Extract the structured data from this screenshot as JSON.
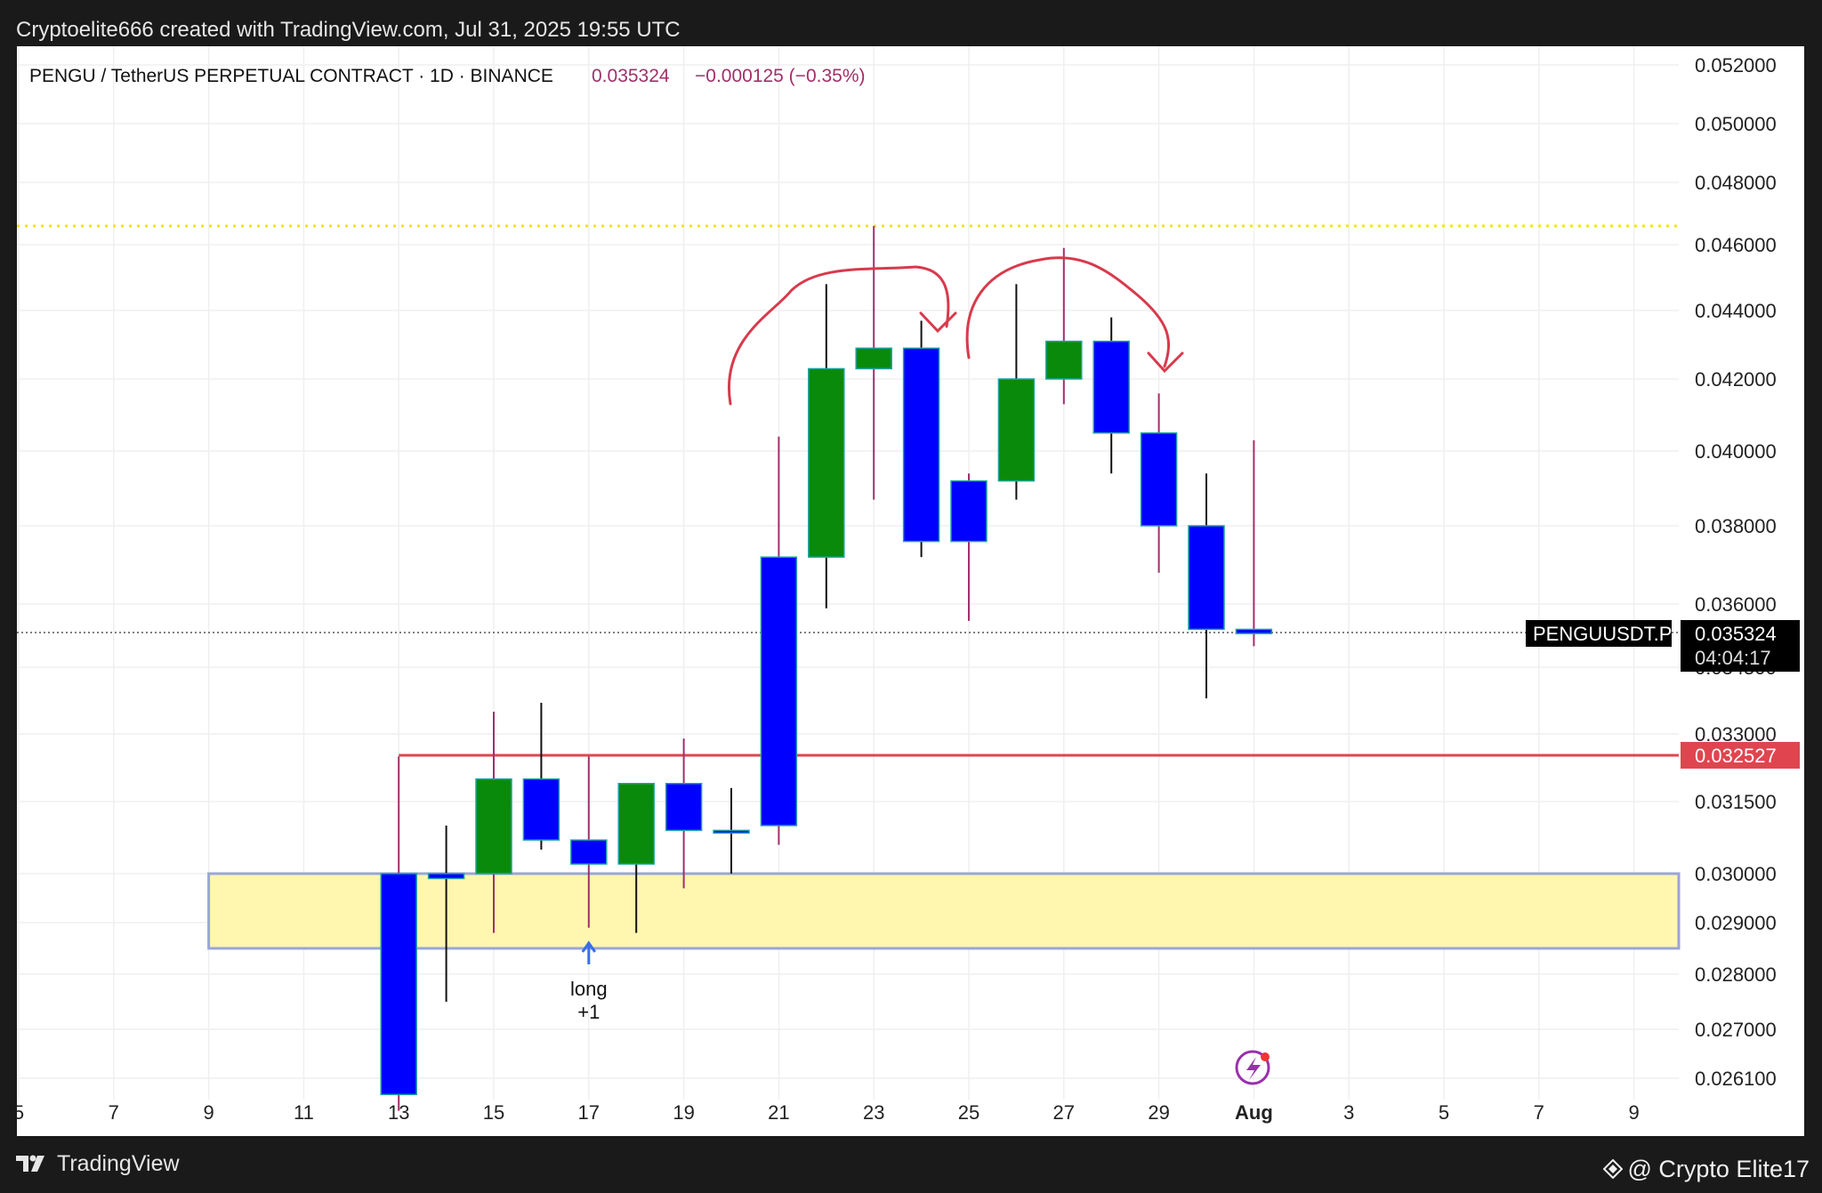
{
  "watermark": "Cryptoelite666 created with TradingView.com, Jul 31, 2025 19:55 UTC",
  "header": {
    "instrument": "PENGU / TetherUS PERPETUAL CONTRACT · 1D · BINANCE",
    "last_price": "0.035324",
    "change": "−0.000125 (−0.35%)"
  },
  "footer": {
    "brand": "TradingView",
    "credit": "@ Crypto Elite17"
  },
  "colors": {
    "up": "#0a8a0a",
    "down": "#0000ff",
    "wick_up": "#a0306a",
    "zone_fill": "#fff6b0",
    "zone_border": "#9aa6d6",
    "resistance": "#e0454f",
    "dotted_level": "#f2e02a",
    "annotation": "#d83a4c",
    "axis_text": "#222222"
  },
  "chart_data": {
    "type": "candlestick",
    "title": "PENGU / TetherUS PERPETUAL CONTRACT · 1D · BINANCE",
    "x_ticks": [
      "5",
      "7",
      "9",
      "11",
      "13",
      "15",
      "17",
      "19",
      "21",
      "23",
      "25",
      "27",
      "29",
      "Aug",
      "3",
      "5",
      "7",
      "9"
    ],
    "y_ticks": [
      "0.052000",
      "0.050000",
      "0.048000",
      "0.046000",
      "0.044000",
      "0.042000",
      "0.040000",
      "0.038000",
      "0.036000",
      "0.034500",
      "0.033000",
      "0.031500",
      "0.030000",
      "0.029000",
      "0.028000",
      "0.027000",
      "0.026100"
    ],
    "y_tick_values": [
      0.052,
      0.05,
      0.048,
      0.046,
      0.044,
      0.042,
      0.04,
      0.038,
      0.036,
      0.0345,
      0.033,
      0.0315,
      0.03,
      0.029,
      0.028,
      0.027,
      0.0261
    ],
    "candles": [
      {
        "date": "Jul 13",
        "open": 0.03,
        "high": 0.0325,
        "low": 0.0255,
        "close": 0.0258
      },
      {
        "date": "Jul 14",
        "open": 0.03,
        "high": 0.031,
        "low": 0.0275,
        "close": 0.0299
      },
      {
        "date": "Jul 15",
        "open": 0.03,
        "high": 0.0335,
        "low": 0.0288,
        "close": 0.032
      },
      {
        "date": "Jul 16",
        "open": 0.032,
        "high": 0.0337,
        "low": 0.0305,
        "close": 0.0307
      },
      {
        "date": "Jul 17",
        "open": 0.0307,
        "high": 0.0325,
        "low": 0.0289,
        "close": 0.0302
      },
      {
        "date": "Jul 18",
        "open": 0.0302,
        "high": 0.0319,
        "low": 0.0288,
        "close": 0.0319
      },
      {
        "date": "Jul 19",
        "open": 0.0319,
        "high": 0.0329,
        "low": 0.0297,
        "close": 0.0309
      },
      {
        "date": "Jul 20",
        "open": 0.0309,
        "high": 0.0318,
        "low": 0.03,
        "close": 0.0309
      },
      {
        "date": "Jul 21",
        "open": 0.0372,
        "high": 0.0404,
        "low": 0.0306,
        "close": 0.031
      },
      {
        "date": "Jul 22",
        "open": 0.0372,
        "high": 0.0448,
        "low": 0.0359,
        "close": 0.0423
      },
      {
        "date": "Jul 23",
        "open": 0.0423,
        "high": 0.0466,
        "low": 0.0387,
        "close": 0.0429
      },
      {
        "date": "Jul 24",
        "open": 0.0429,
        "high": 0.0437,
        "low": 0.0372,
        "close": 0.0376
      },
      {
        "date": "Jul 25",
        "open": 0.0392,
        "high": 0.0394,
        "low": 0.0356,
        "close": 0.0376
      },
      {
        "date": "Jul 26",
        "open": 0.0392,
        "high": 0.0448,
        "low": 0.0387,
        "close": 0.042
      },
      {
        "date": "Jul 27",
        "open": 0.042,
        "high": 0.0459,
        "low": 0.0413,
        "close": 0.0431
      },
      {
        "date": "Jul 28",
        "open": 0.0431,
        "high": 0.0438,
        "low": 0.0394,
        "close": 0.0405
      },
      {
        "date": "Jul 29",
        "open": 0.0405,
        "high": 0.0416,
        "low": 0.0368,
        "close": 0.038
      },
      {
        "date": "Jul 30",
        "open": 0.038,
        "high": 0.0394,
        "low": 0.0338,
        "close": 0.0354
      },
      {
        "date": "Jul 31",
        "open": 0.0354,
        "high": 0.0403,
        "low": 0.035,
        "close": 0.0353
      }
    ],
    "price_labels": [
      {
        "symbol": "PENGUUSDT.P",
        "price": "0.035324",
        "countdown": "04:04:17"
      },
      {
        "price": "0.032527"
      }
    ],
    "levels": {
      "current": 0.035324,
      "resistance": 0.032527,
      "dotted": 0.0466
    },
    "zone": {
      "from": 0.0285,
      "to": 0.03
    },
    "annotations": [
      {
        "text_line1": "long",
        "text_line2": "+1",
        "date": "Jul 17"
      }
    ],
    "grid": true
  }
}
